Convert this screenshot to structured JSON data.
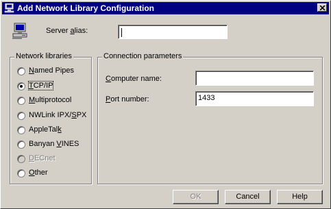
{
  "window": {
    "title": "Add Network Library Configuration",
    "title_icon": "network-computer-icon",
    "close_icon": "close-icon"
  },
  "server": {
    "icon": "server-computer-icon",
    "alias_label_before": "Server ",
    "alias_label_accel": "a",
    "alias_label_after": "lias:",
    "alias_value": ""
  },
  "network_libraries": {
    "title": "Network libraries",
    "selected": "TCP/IP",
    "options": [
      {
        "label": "Named Pipes",
        "checked": false,
        "enabled": true
      },
      {
        "label": "TCP/IP",
        "checked": true,
        "enabled": true
      },
      {
        "label": "Multiprotocol",
        "checked": false,
        "enabled": true
      },
      {
        "label": "NWLink IPX/SPX",
        "checked": false,
        "enabled": true
      },
      {
        "label": "AppleTalk",
        "checked": false,
        "enabled": true
      },
      {
        "label": "Banyan VINES",
        "checked": false,
        "enabled": true
      },
      {
        "label": "DECnet",
        "checked": false,
        "enabled": false
      },
      {
        "label": "Other",
        "checked": false,
        "enabled": true
      }
    ]
  },
  "connection": {
    "title": "Connection parameters",
    "computer_name_label": "Computer name:",
    "computer_name_value": "",
    "port_label": "Port number:",
    "port_value": "1433"
  },
  "buttons": {
    "ok": "OK",
    "cancel": "Cancel",
    "help": "Help"
  },
  "colors": {
    "face": "#d4d0c8",
    "titlebar": "#000080"
  }
}
